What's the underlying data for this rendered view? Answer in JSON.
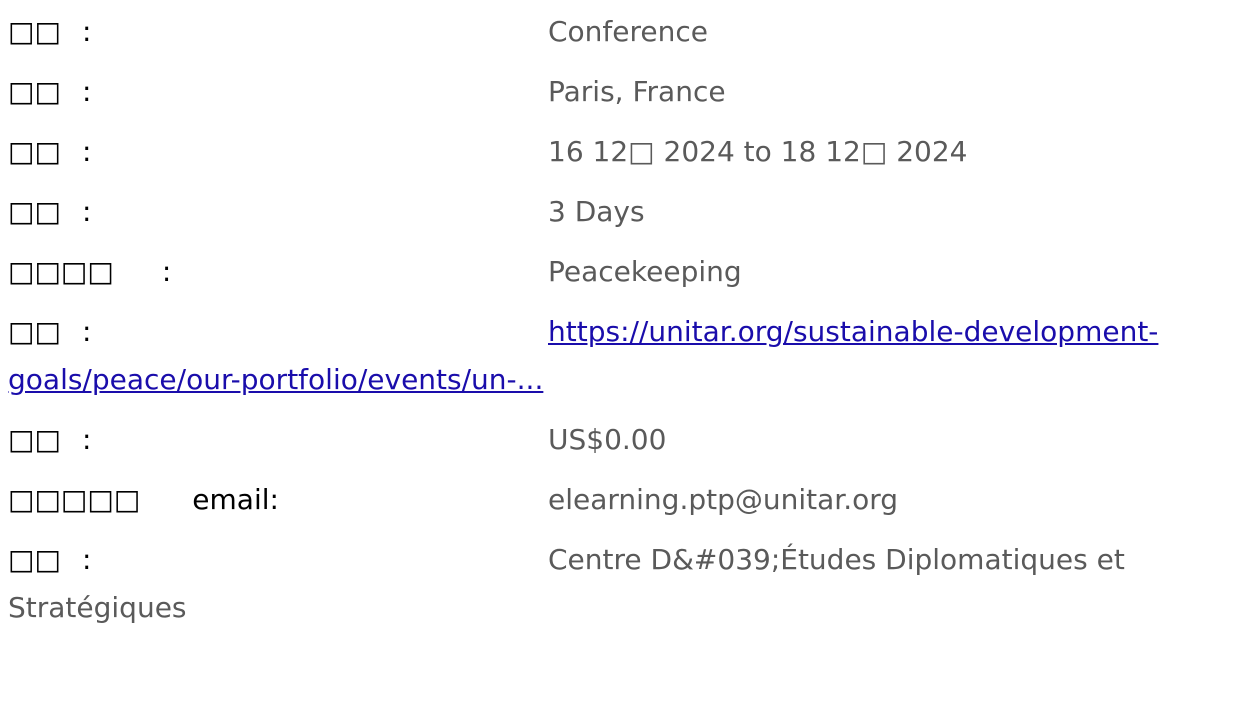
{
  "event_details": {
    "rows": [
      {
        "label": "□□",
        "colon": ":",
        "value": "Conference"
      },
      {
        "label": "□□",
        "colon": ":",
        "value": "Paris, France"
      },
      {
        "label": "□□",
        "colon": ":",
        "value": "16 12□  2024 to 18 12□  2024"
      },
      {
        "label": "□□",
        "colon": ":",
        "value": "3 Days"
      },
      {
        "label": "□□□□",
        "colon": ":",
        "value": "Peacekeeping"
      },
      {
        "label": "□□",
        "colon": ":",
        "value": "https://unitar.org/sustainable-development-goals/peace/our-portfolio/events/un-..."
      },
      {
        "label": "□□",
        "colon": ":",
        "value": "US$0.00"
      },
      {
        "label": "□□□□□",
        "colon": "email:",
        "value": "elearning.ptp@unitar.org"
      },
      {
        "label": "□□",
        "colon": ":",
        "value": "Centre D&#039;Études Diplomatiques et Stratégiques"
      }
    ]
  }
}
